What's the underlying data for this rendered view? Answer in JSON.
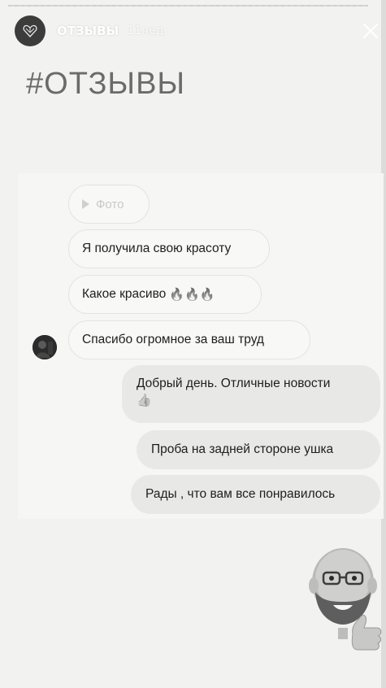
{
  "story": {
    "account_name": "ОТЗЫВЫ",
    "posted_ago": "11нед.",
    "title": "#ОТЗЫВЫ",
    "close_icon": "close-icon",
    "avatar_icon": "heart-logo-icon"
  },
  "messages": {
    "photo_label": "Фото",
    "incoming": [
      {
        "text": "Я получила свою красоту"
      },
      {
        "text": "Какое красиво",
        "emoji": "🔥🔥🔥"
      },
      {
        "text": "Спасибо огромное за ваш труд"
      }
    ],
    "outgoing": [
      {
        "text": "Добрый день. Отличные новости",
        "emoji": "👍"
      },
      {
        "text": "Проба на задней стороне ушка"
      },
      {
        "text": "Рады , что вам все понравилось"
      }
    ]
  },
  "sticker": {
    "icon": "memoji-thumbs-up-sticker"
  },
  "colors": {
    "background": "#f2f2f0",
    "incoming_bubble": "#f8f8f6",
    "outgoing_bubble": "#e8e8e6",
    "title": "#6b6b6b"
  }
}
